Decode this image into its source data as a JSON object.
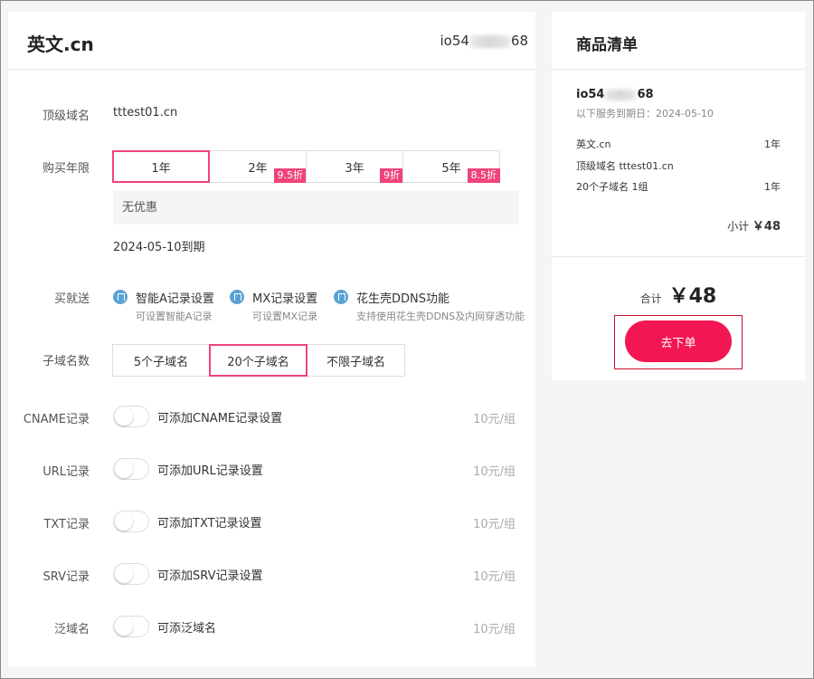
{
  "main": {
    "title": "英文.cn",
    "account_id_prefix": "io54",
    "account_id_suffix": "68"
  },
  "form": {
    "top_domain": {
      "label": "顶级域名",
      "value": "tttest01.cn"
    },
    "years": {
      "label": "购买年限",
      "options": [
        {
          "label": "1年",
          "discount": "",
          "selected": true
        },
        {
          "label": "2年",
          "discount": "9.5折",
          "selected": false
        },
        {
          "label": "3年",
          "discount": "9折",
          "selected": false
        },
        {
          "label": "5年",
          "discount": "8.5折",
          "selected": false
        }
      ],
      "discount_note": "无优惠",
      "expiry": "2024-05-10到期"
    },
    "gifts": {
      "label": "买就送",
      "items": [
        {
          "title": "智能A记录设置",
          "desc": "可设置智能A记录"
        },
        {
          "title": "MX记录设置",
          "desc": "可设置MX记录"
        },
        {
          "title": "花生壳DDNS功能",
          "desc": "支持使用花生壳DDNS及内网穿透功能"
        }
      ]
    },
    "subdomains": {
      "label": "子域名数",
      "options": [
        {
          "label": "5个子域名",
          "selected": false
        },
        {
          "label": "20个子域名",
          "selected": true
        },
        {
          "label": "不限子域名",
          "selected": false
        }
      ]
    },
    "addons": [
      {
        "label": "CNAME记录",
        "desc": "可添加CNAME记录设置",
        "price": "10元/组",
        "enabled": false
      },
      {
        "label": "URL记录",
        "desc": "可添加URL记录设置",
        "price": "10元/组",
        "enabled": false
      },
      {
        "label": "TXT记录",
        "desc": "可添加TXT记录设置",
        "price": "10元/组",
        "enabled": false
      },
      {
        "label": "SRV记录",
        "desc": "可添加SRV记录设置",
        "price": "10元/组",
        "enabled": false
      },
      {
        "label": "泛域名",
        "desc": "可添泛域名",
        "price": "10元/组",
        "enabled": false
      }
    ]
  },
  "cart": {
    "title": "商品清单",
    "order_id_prefix": "io54",
    "order_id_suffix": "68",
    "service_date": "以下服务到期日：2024-05-10",
    "items": [
      {
        "name": "英文.cn",
        "qty": "1年"
      },
      {
        "name": "顶级域名 tttest01.cn",
        "qty": ""
      },
      {
        "name": "20个子域名 1组",
        "qty": "1年"
      }
    ],
    "subtotal_label": "小计",
    "subtotal_value": "￥48",
    "total_label": "合计",
    "total_value": "￥48",
    "submit_label": "去下单"
  },
  "colors": {
    "accent": "#f0437a",
    "submit": "#f21652",
    "gift_icon": "#5aa2d4"
  }
}
